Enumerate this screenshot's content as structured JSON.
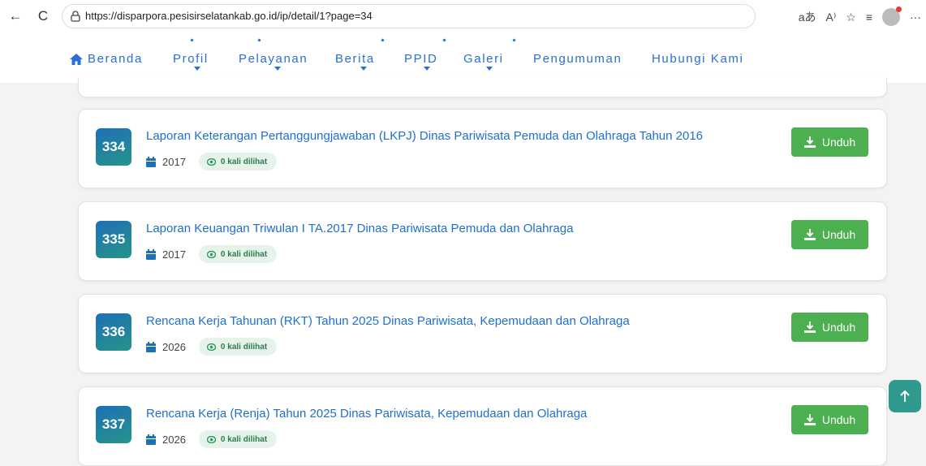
{
  "browser": {
    "url": "https://disparpora.pesisirselatankab.go.id/ip/detail/1?page=34",
    "back_icon": "←",
    "refresh_icon": "C",
    "more_icon": "···"
  },
  "nav": {
    "items": [
      {
        "label": "Beranda"
      },
      {
        "label": "Profil"
      },
      {
        "label": "Pelayanan"
      },
      {
        "label": "Berita"
      },
      {
        "label": "PPID"
      },
      {
        "label": "Galeri"
      },
      {
        "label": "Pengumuman"
      },
      {
        "label": "Hubungi Kami"
      }
    ]
  },
  "documents": [
    {
      "number": "334",
      "title": "Laporan Keterangan Pertanggungjawaban (LKPJ) Dinas Pariwisata Pemuda dan Olahraga Tahun 2016",
      "year": "2017",
      "views": "0 kali dilihat",
      "download_label": "Unduh"
    },
    {
      "number": "335",
      "title": "Laporan Keuangan Triwulan I TA.2017 Dinas Pariwisata Pemuda dan Olahraga",
      "year": "2017",
      "views": "0 kali dilihat",
      "download_label": "Unduh"
    },
    {
      "number": "336",
      "title": "Rencana Kerja Tahunan (RKT) Tahun 2025 Dinas Pariwisata, Kepemudaan dan Olahraga",
      "year": "2026",
      "views": "0 kali dilihat",
      "download_label": "Unduh"
    },
    {
      "number": "337",
      "title": "Rencana Kerja (Renja) Tahun 2025 Dinas Pariwisata, Kepemudaan dan Olahraga",
      "year": "2026",
      "views": "0 kali dilihat",
      "download_label": "Unduh"
    }
  ],
  "colors": {
    "link_blue": "#1f6fcf",
    "download_green": "#4caf50",
    "badge_gradient_start": "#1f6fb5",
    "badge_gradient_end": "#26948a"
  }
}
